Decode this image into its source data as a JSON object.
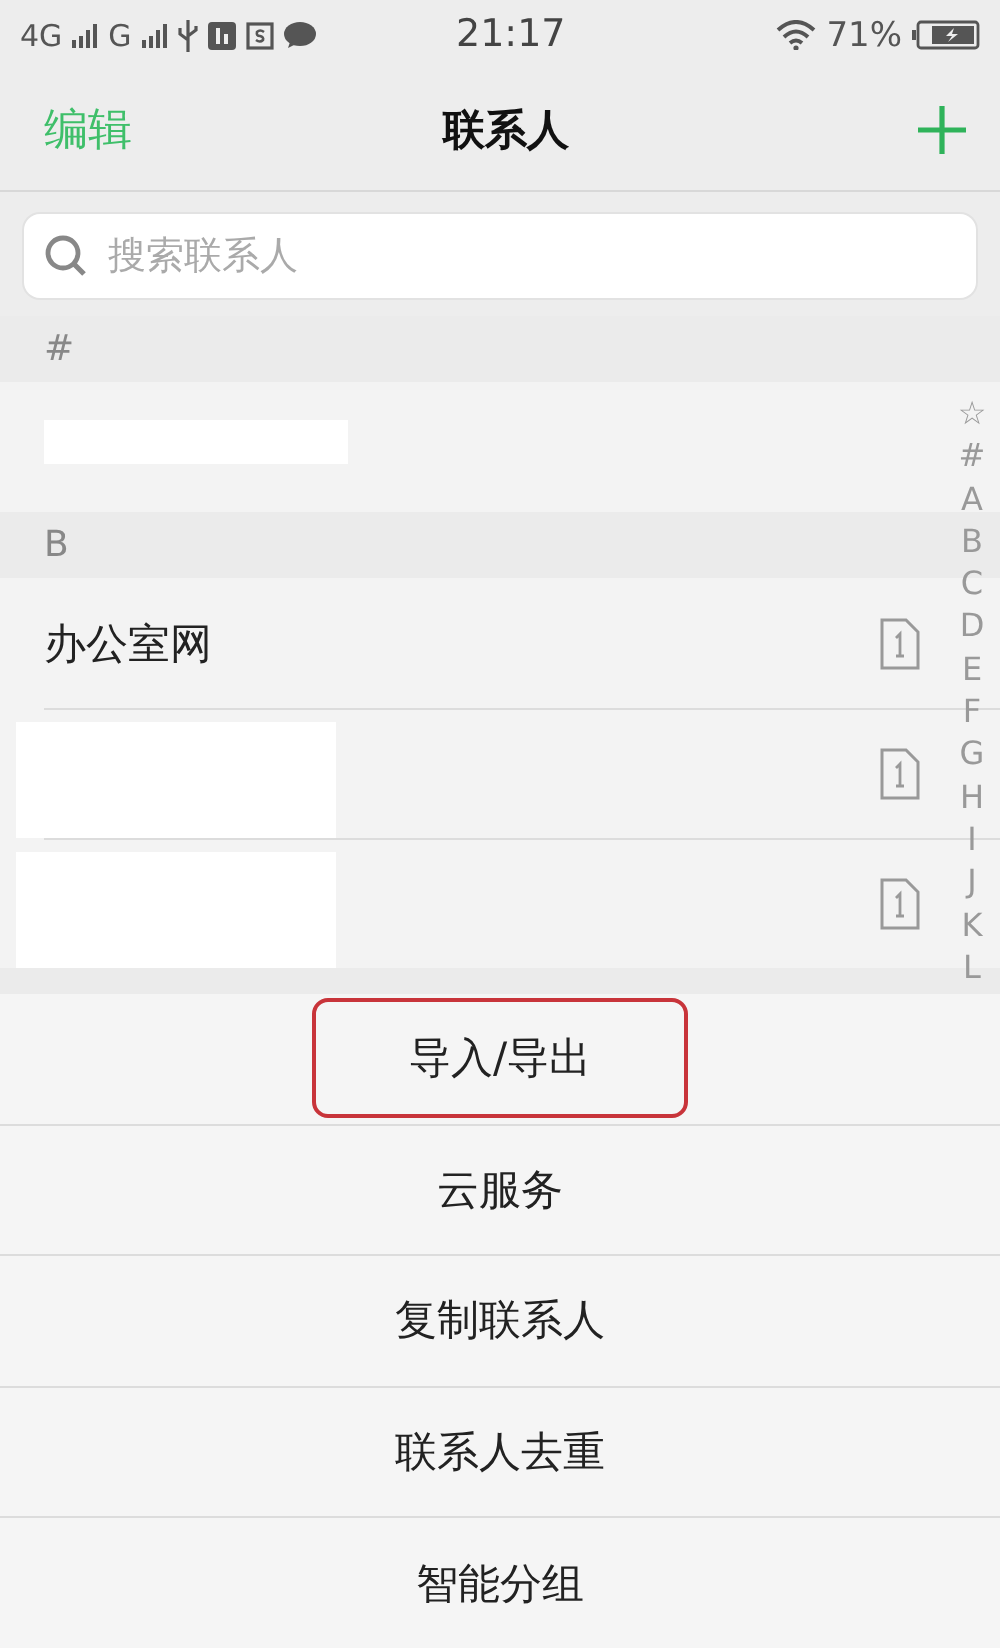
{
  "status_bar": {
    "network_1": "4G",
    "network_2": "G",
    "time": "21:17",
    "battery": "71%"
  },
  "header": {
    "edit": "编辑",
    "title": "联系人"
  },
  "search": {
    "placeholder": "搜索联系人"
  },
  "sections": [
    {
      "letter": "#",
      "contacts": [
        {
          "kind": "redacted",
          "sim": false
        }
      ]
    },
    {
      "letter": "B",
      "contacts": [
        {
          "kind": "named",
          "name": "办公室网",
          "sim": true
        },
        {
          "kind": "redacted",
          "sim": true
        },
        {
          "kind": "redacted",
          "sim": true
        }
      ]
    }
  ],
  "index": [
    "☆",
    "#",
    "A",
    "B",
    "C",
    "D",
    "E",
    "F",
    "G",
    "H",
    "I",
    "J",
    "K",
    "L"
  ],
  "menu": [
    {
      "label": "导入/导出",
      "highlighted": true
    },
    {
      "label": "云服务",
      "highlighted": false
    },
    {
      "label": "复制联系人",
      "highlighted": false
    },
    {
      "label": "联系人去重",
      "highlighted": false
    },
    {
      "label": "智能分组",
      "highlighted": false
    }
  ]
}
